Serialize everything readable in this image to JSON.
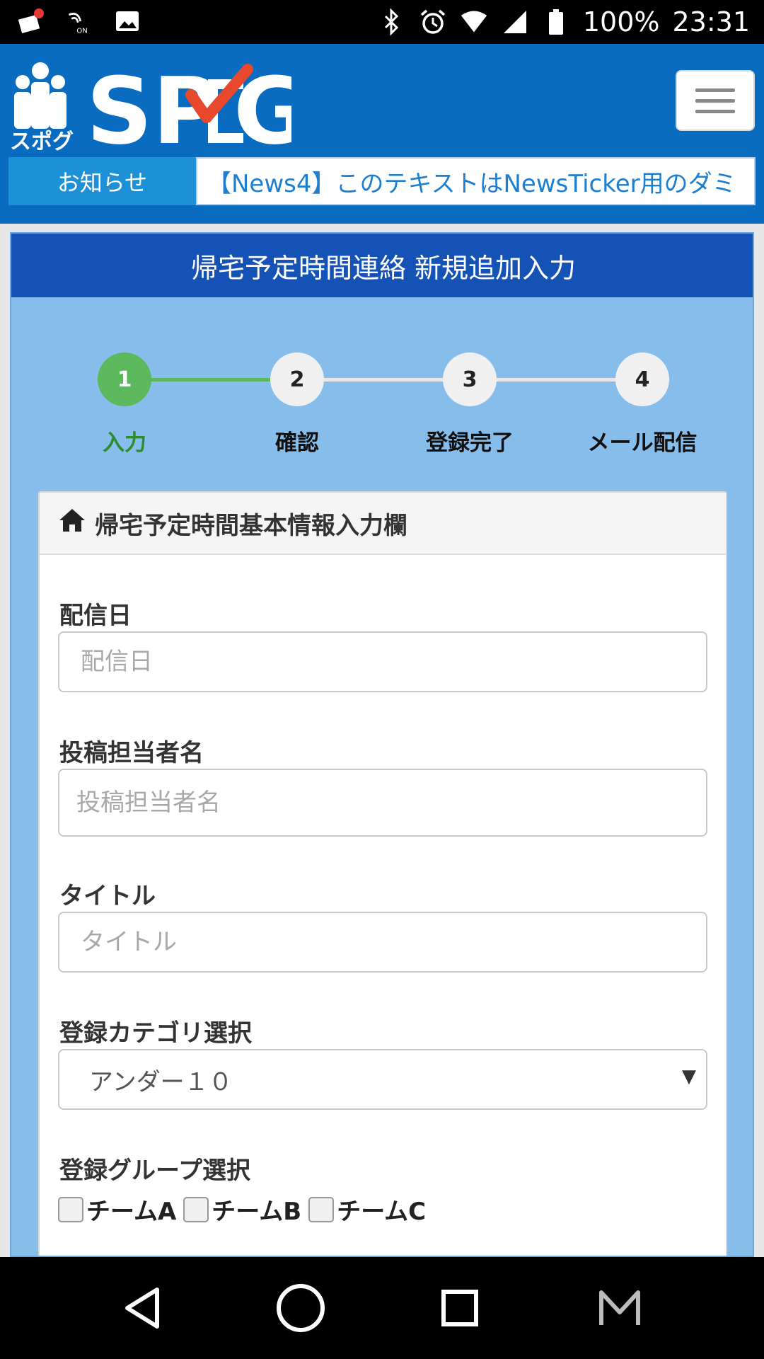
{
  "status_bar": {
    "battery": "100%",
    "time": "23:31",
    "icons": [
      "notification-icon",
      "nfc-on-icon",
      "image-icon",
      "bluetooth-icon",
      "alarm-icon",
      "wifi-icon",
      "signal-icon",
      "battery-icon"
    ]
  },
  "header": {
    "logo_text": "SPOG",
    "logo_sub": "スポグ",
    "news_label": "お知らせ",
    "news_text": "【News4】このテキストはNewsTicker用のダミ",
    "colors": {
      "header_bg": "#0a6cc0",
      "news_label_bg": "#1e90d6",
      "logo_check": "#e8492c"
    }
  },
  "page": {
    "title": "帰宅予定時間連絡 新規追加入力"
  },
  "steps": [
    {
      "number": "1",
      "label": "入力",
      "active": true
    },
    {
      "number": "2",
      "label": "確認",
      "active": false
    },
    {
      "number": "3",
      "label": "登録完了",
      "active": false
    },
    {
      "number": "4",
      "label": "メール配信",
      "active": false
    }
  ],
  "form": {
    "panel_title": "帰宅予定時間基本情報入力欄",
    "delivery_date": {
      "label": "配信日",
      "placeholder": "配信日"
    },
    "author": {
      "label": "投稿担当者名",
      "placeholder": "投稿担当者名"
    },
    "title": {
      "label": "タイトル",
      "placeholder": "タイトル"
    },
    "category": {
      "label": "登録カテゴリ選択",
      "selected": "アンダー１０"
    },
    "groups": {
      "label": "登録グループ選択",
      "options": [
        "チームA",
        "チームB",
        "チームC"
      ]
    }
  },
  "colors": {
    "active_step": "#5cb85c",
    "inactive_step": "#f0f0f0",
    "title_bar": "#1552b5",
    "card_bg": "#86bdeb"
  }
}
